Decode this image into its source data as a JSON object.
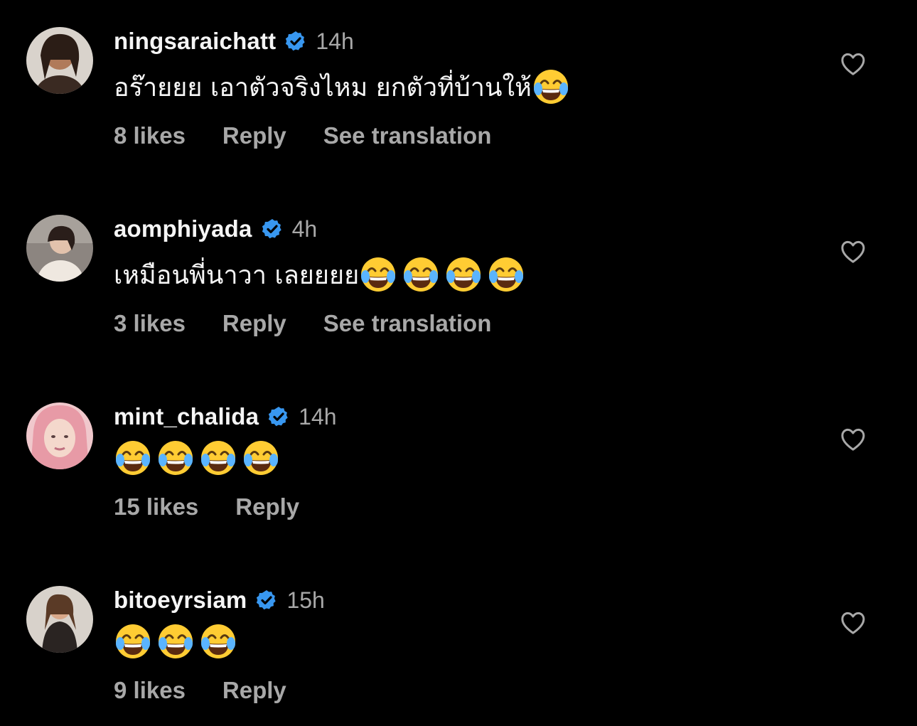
{
  "comments": [
    {
      "username": "ningsaraichatt",
      "verified": true,
      "time": "14h",
      "text": "อร๊ายยย เอาตัวจริงไหม ยกตัวที่บ้านให้",
      "emoji": [
        "face-with-tears-of-joy"
      ],
      "likes": "8 likes",
      "reply": "Reply",
      "translate": "See translation",
      "avatar_color": "#6b5a4a"
    },
    {
      "username": "aomphiyada",
      "verified": true,
      "time": "4h",
      "text": "เหมือนพี่นาวา เลยยยย",
      "emoji": [
        "face-with-tears-of-joy",
        "face-with-tears-of-joy",
        "face-with-tears-of-joy",
        "face-with-tears-of-joy"
      ],
      "likes": "3 likes",
      "reply": "Reply",
      "translate": "See translation",
      "avatar_color": "#7a7068"
    },
    {
      "username": "mint_chalida",
      "verified": true,
      "time": "14h",
      "text": "",
      "emoji": [
        "face-with-tears-of-joy",
        "face-with-tears-of-joy",
        "face-with-tears-of-joy",
        "face-with-tears-of-joy"
      ],
      "likes": "15 likes",
      "reply": "Reply",
      "translate": "",
      "avatar_color": "#e8a3ad"
    },
    {
      "username": "bitoeyrsiam",
      "verified": true,
      "time": "15h",
      "text": "",
      "emoji": [
        "face-with-tears-of-joy",
        "face-with-tears-of-joy",
        "face-with-tears-of-joy"
      ],
      "likes": "9 likes",
      "reply": "Reply",
      "translate": "",
      "avatar_color": "#8a7a6e"
    }
  ],
  "colors": {
    "background": "#000000",
    "text": "#f5f5f5",
    "muted": "#a8a8a8",
    "verified_badge": "#3897f0",
    "emoji_face": "#ffcc33"
  }
}
